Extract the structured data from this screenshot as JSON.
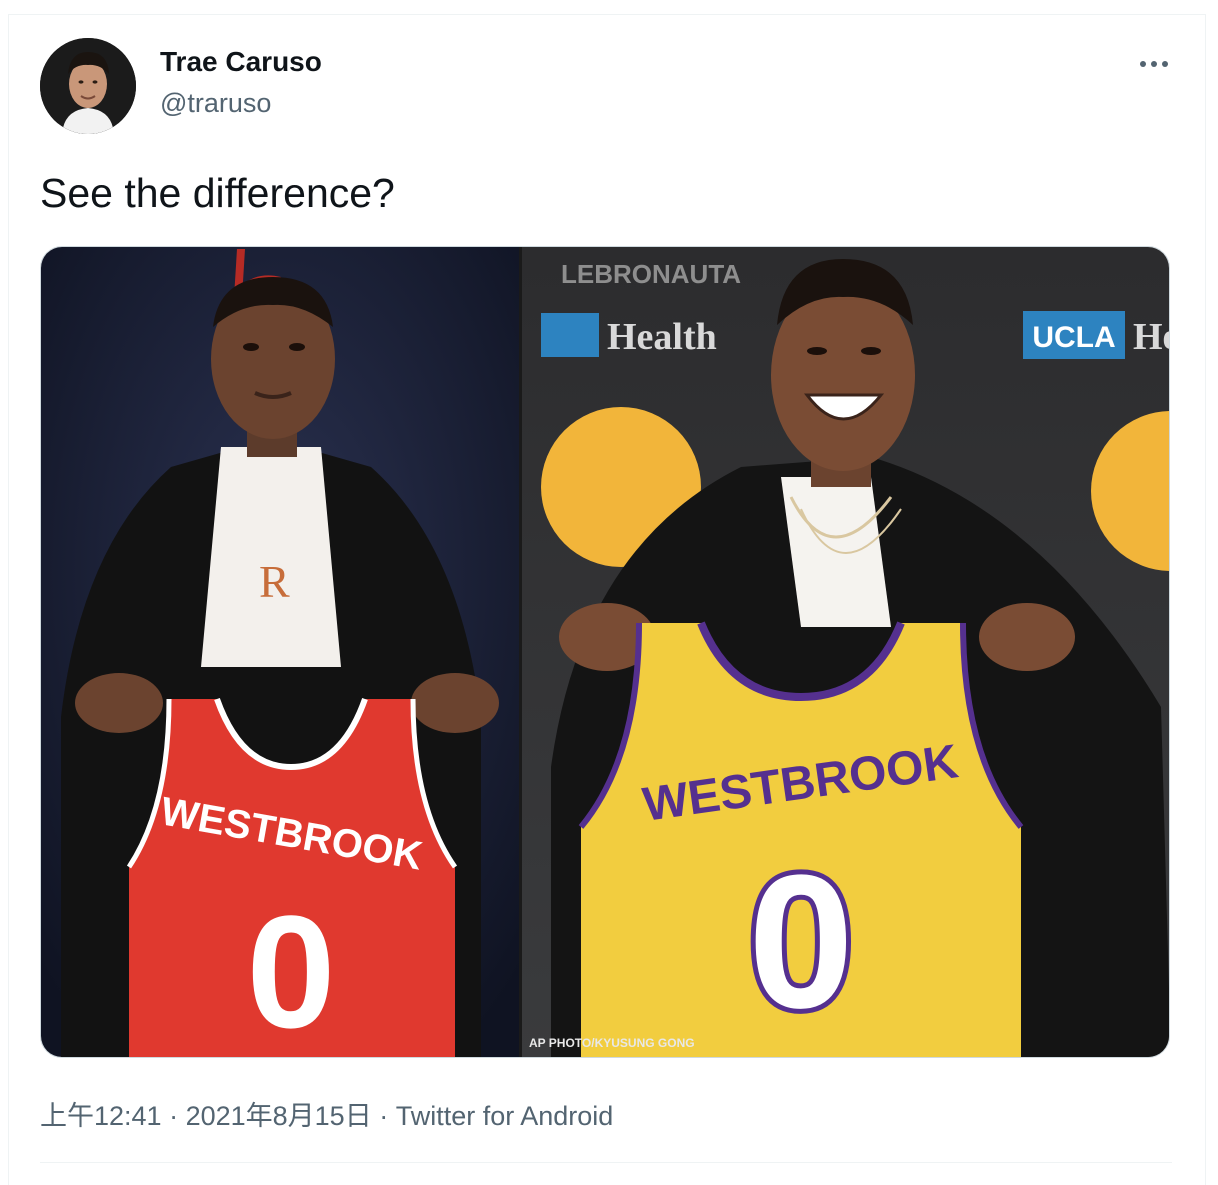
{
  "tweet": {
    "author_name": "Trae Caruso",
    "author_handle": "@traruso",
    "text": "See the difference?",
    "timestamp": "上午12:41",
    "date": "2021年8月15日",
    "source": "Twitter for Android",
    "separator": " · "
  },
  "media": {
    "left_panel": {
      "jersey_name": "WESTBROOK",
      "jersey_number": "0",
      "jersey_color": "#e0392f"
    },
    "right_panel": {
      "watermark": "LEBRONAUTA",
      "sponsor_left": "Health",
      "sponsor_badge": "UCLA",
      "sponsor_right": "He",
      "jersey_name": "WESTBROOK",
      "jersey_number": "0",
      "jersey_color": "#f2cd3f",
      "photo_credit": "AP PHOTO/KYUSUNG GONG"
    }
  },
  "icons": {
    "more": "more-horizontal-icon",
    "avatar": "avatar"
  }
}
